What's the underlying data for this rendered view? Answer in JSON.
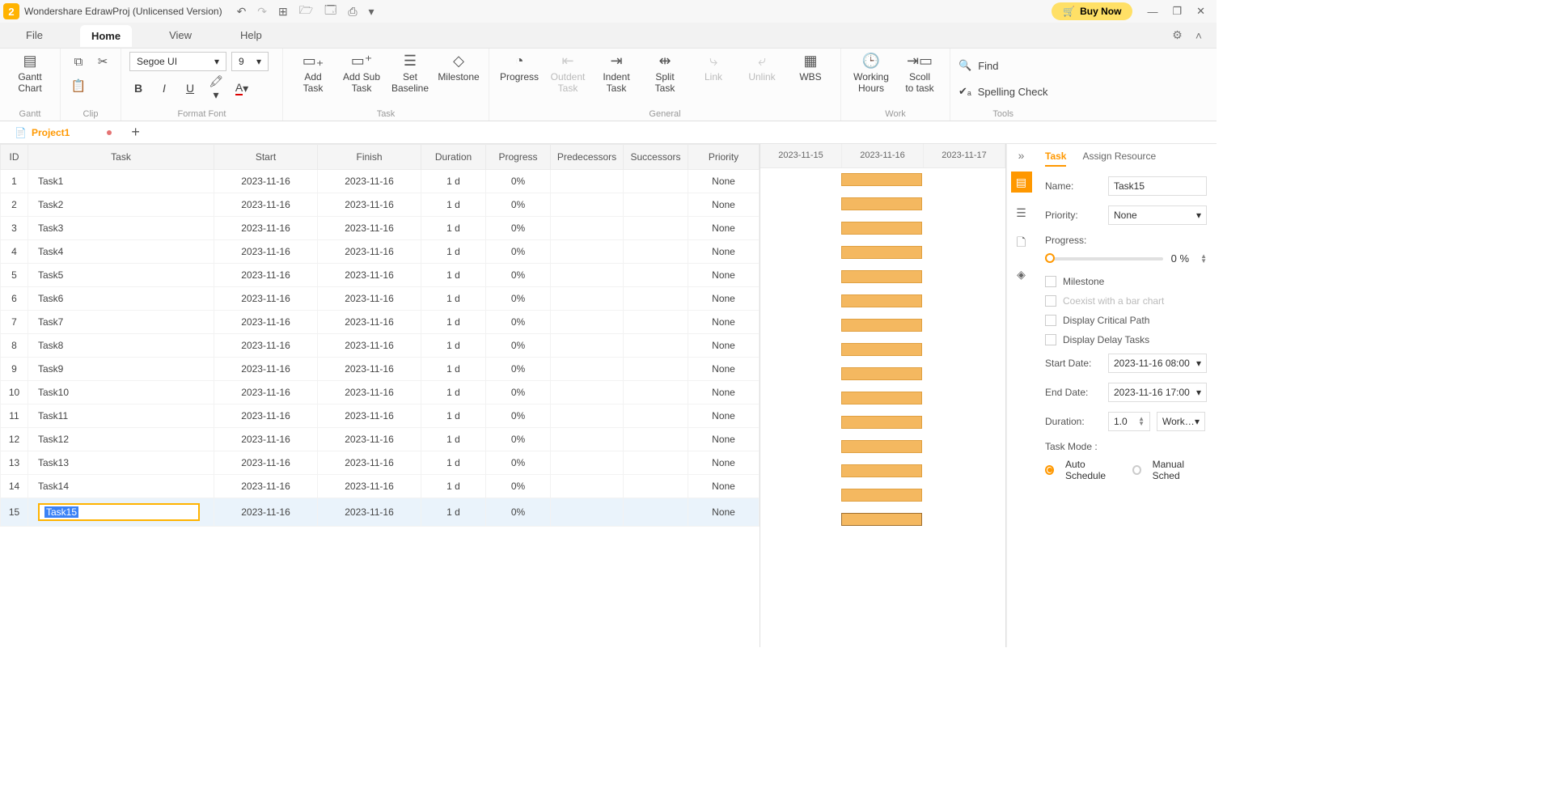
{
  "app": {
    "title": "Wondershare EdrawProj (Unlicensed Version)",
    "buyNow": "Buy Now",
    "logoGlyph": "2"
  },
  "menubar": {
    "file": "File",
    "home": "Home",
    "view": "View",
    "help": "Help"
  },
  "ribbon": {
    "gantt": {
      "label": "Gantt",
      "ganttChart": "Gantt\nChart"
    },
    "clip": {
      "label": "Clip"
    },
    "formatFont": {
      "label": "Format Font",
      "fontName": "Segoe UI",
      "fontSize": "9"
    },
    "task": {
      "label": "Task",
      "addTask": "Add\nTask",
      "addSubTask": "Add Sub\nTask",
      "setBaseline": "Set\nBaseline",
      "milestone": "Milestone"
    },
    "general": {
      "label": "General",
      "progress": "Progress",
      "outdent": "Outdent\nTask",
      "indent": "Indent\nTask",
      "split": "Split\nTask",
      "link": "Link",
      "unlink": "Unlink",
      "wbs": "WBS"
    },
    "work": {
      "label": "Work",
      "workingHours": "Working\nHours",
      "scrollToTask": "Scoll\nto task"
    },
    "tools": {
      "label": "Tools",
      "find": "Find",
      "spelling": "Spelling Check"
    }
  },
  "doc": {
    "name": "Project1"
  },
  "columns": {
    "id": "ID",
    "task": "Task",
    "start": "Start",
    "finish": "Finish",
    "duration": "Duration",
    "progress": "Progress",
    "predecessors": "Predecessors",
    "successors": "Successors",
    "priority": "Priority"
  },
  "timeline": {
    "d1": "2023-11-15",
    "d2": "2023-11-16",
    "d3": "2023-11-17"
  },
  "rows": [
    {
      "id": "1",
      "name": "Task1",
      "start": "2023-11-16",
      "finish": "2023-11-16",
      "dur": "1 d",
      "prog": "0%",
      "pred": "",
      "succ": "",
      "prio": "None"
    },
    {
      "id": "2",
      "name": "Task2",
      "start": "2023-11-16",
      "finish": "2023-11-16",
      "dur": "1 d",
      "prog": "0%",
      "pred": "",
      "succ": "",
      "prio": "None"
    },
    {
      "id": "3",
      "name": "Task3",
      "start": "2023-11-16",
      "finish": "2023-11-16",
      "dur": "1 d",
      "prog": "0%",
      "pred": "",
      "succ": "",
      "prio": "None"
    },
    {
      "id": "4",
      "name": "Task4",
      "start": "2023-11-16",
      "finish": "2023-11-16",
      "dur": "1 d",
      "prog": "0%",
      "pred": "",
      "succ": "",
      "prio": "None"
    },
    {
      "id": "5",
      "name": "Task5",
      "start": "2023-11-16",
      "finish": "2023-11-16",
      "dur": "1 d",
      "prog": "0%",
      "pred": "",
      "succ": "",
      "prio": "None"
    },
    {
      "id": "6",
      "name": "Task6",
      "start": "2023-11-16",
      "finish": "2023-11-16",
      "dur": "1 d",
      "prog": "0%",
      "pred": "",
      "succ": "",
      "prio": "None"
    },
    {
      "id": "7",
      "name": "Task7",
      "start": "2023-11-16",
      "finish": "2023-11-16",
      "dur": "1 d",
      "prog": "0%",
      "pred": "",
      "succ": "",
      "prio": "None"
    },
    {
      "id": "8",
      "name": "Task8",
      "start": "2023-11-16",
      "finish": "2023-11-16",
      "dur": "1 d",
      "prog": "0%",
      "pred": "",
      "succ": "",
      "prio": "None"
    },
    {
      "id": "9",
      "name": "Task9",
      "start": "2023-11-16",
      "finish": "2023-11-16",
      "dur": "1 d",
      "prog": "0%",
      "pred": "",
      "succ": "",
      "prio": "None"
    },
    {
      "id": "10",
      "name": "Task10",
      "start": "2023-11-16",
      "finish": "2023-11-16",
      "dur": "1 d",
      "prog": "0%",
      "pred": "",
      "succ": "",
      "prio": "None"
    },
    {
      "id": "11",
      "name": "Task11",
      "start": "2023-11-16",
      "finish": "2023-11-16",
      "dur": "1 d",
      "prog": "0%",
      "pred": "",
      "succ": "",
      "prio": "None"
    },
    {
      "id": "12",
      "name": "Task12",
      "start": "2023-11-16",
      "finish": "2023-11-16",
      "dur": "1 d",
      "prog": "0%",
      "pred": "",
      "succ": "",
      "prio": "None"
    },
    {
      "id": "13",
      "name": "Task13",
      "start": "2023-11-16",
      "finish": "2023-11-16",
      "dur": "1 d",
      "prog": "0%",
      "pred": "",
      "succ": "",
      "prio": "None"
    },
    {
      "id": "14",
      "name": "Task14",
      "start": "2023-11-16",
      "finish": "2023-11-16",
      "dur": "1 d",
      "prog": "0%",
      "pred": "",
      "succ": "",
      "prio": "None"
    },
    {
      "id": "15",
      "name": "Task15",
      "start": "2023-11-16",
      "finish": "2023-11-16",
      "dur": "1 d",
      "prog": "0%",
      "pred": "",
      "succ": "",
      "prio": "None"
    }
  ],
  "selectedIndex": 14,
  "prop": {
    "tabTask": "Task",
    "tabAssign": "Assign Resource",
    "nameLabel": "Name:",
    "nameVal": "Task15",
    "priorityLabel": "Priority:",
    "priorityVal": "None",
    "progressLabel": "Progress:",
    "progressVal": "0 %",
    "milestone": "Milestone",
    "coexist": "Coexist with a bar chart",
    "critical": "Display Critical Path",
    "delay": "Display Delay Tasks",
    "startLabel": "Start Date:",
    "startVal": "2023-11-16 08:00",
    "endLabel": "End Date:",
    "endVal": "2023-11-16 17:00",
    "durLabel": "Duration:",
    "durVal": "1.0",
    "durUnit": "Work…",
    "modeLabel": "Task Mode :",
    "auto": "Auto Schedule",
    "manual": "Manual Sched"
  }
}
